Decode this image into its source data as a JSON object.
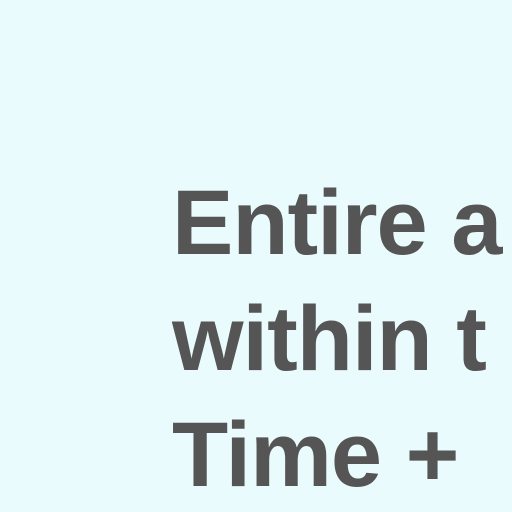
{
  "content": {
    "lines": [
      "Entire a",
      "within t",
      "Time +"
    ]
  },
  "colors": {
    "background": "#e9fbfd",
    "text": "#555555"
  }
}
